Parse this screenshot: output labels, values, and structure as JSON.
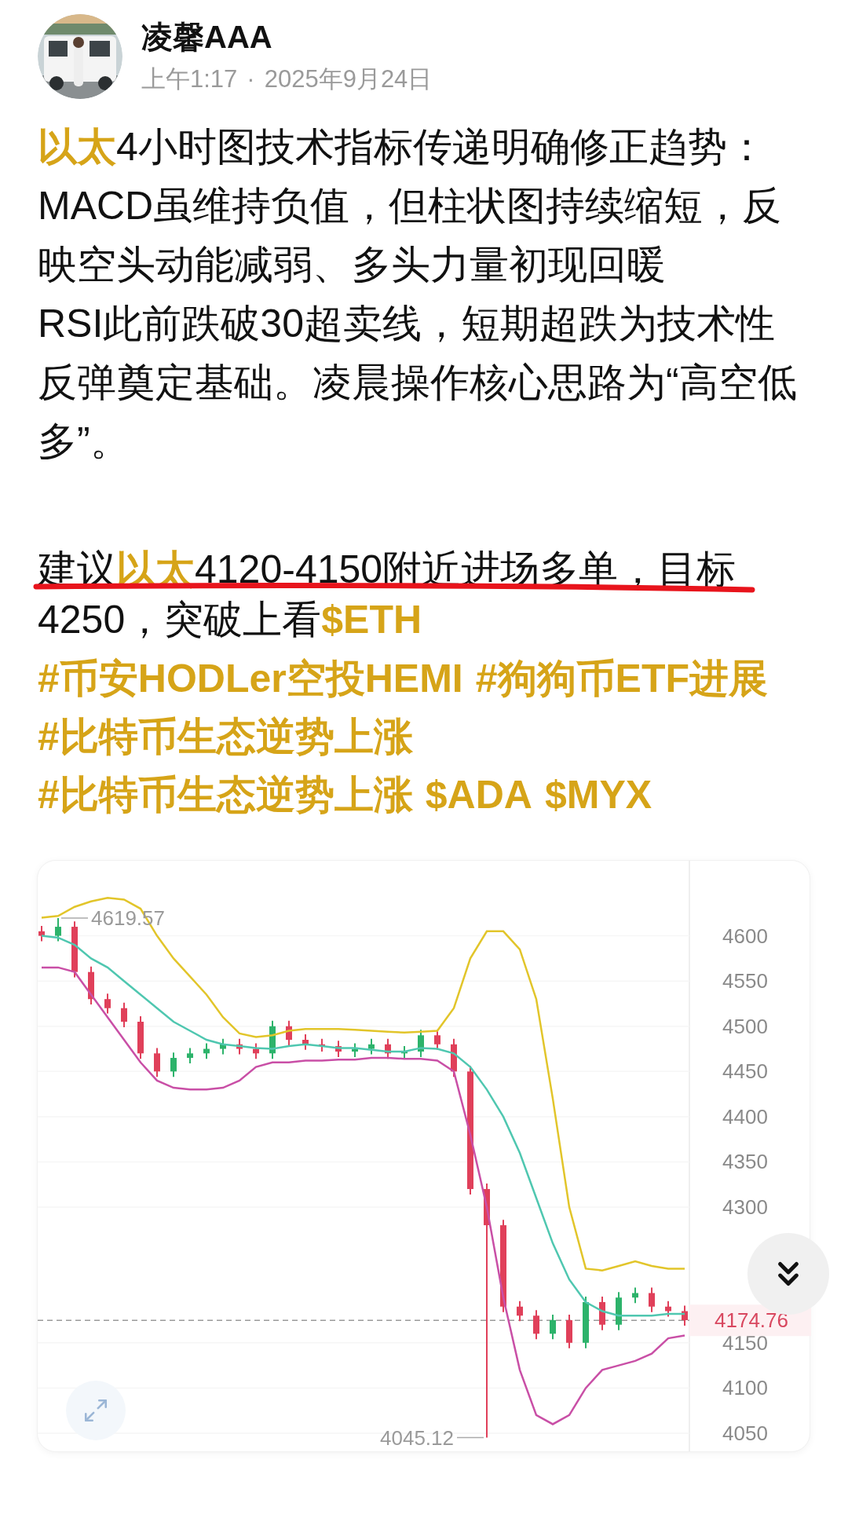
{
  "post": {
    "author": {
      "name": "凌馨AAA",
      "time": "上午1:17",
      "separator": "·",
      "date": "2025年9月24日"
    },
    "paragraphs": [
      "**以太**4小时图技术指标传递明确修正趋势：MACD虽维持负值，但柱状图持续缩短，反映空头动能减弱、多头力量初现回暖",
      "RSI此前跌破30超卖线，短期超跌为技术性反弹奠定基础。凌晨操作核心思路为“高空低多”。"
    ],
    "advice_lines": [
      {
        "text": "建议**以太**4120-4150附近进场多单，目标",
        "underlined": true
      },
      {
        "text": "4250，突破上看**$ETH**"
      }
    ],
    "tag_lines": [
      [
        "#币安HODLer空投HEMI",
        "#狗狗币ETF进展"
      ],
      [
        "#比特币生态逆势上涨"
      ],
      [
        "#比特币生态逆势上涨",
        "$ADA",
        "$MYX"
      ]
    ],
    "chart": {
      "chart_data": {
        "type": "candlestick",
        "grid": true,
        "ylim": [
          4030,
          4683
        ],
        "yticks": [
          4600,
          4550,
          4500,
          4450,
          4400,
          4350,
          4300,
          4150,
          4100,
          4050
        ],
        "ohlc": [
          [
            4605,
            4611,
            4594,
            4600
          ],
          [
            4600,
            4619.57,
            4594,
            4610
          ],
          [
            4610,
            4616,
            4554,
            4560
          ],
          [
            4560,
            4566,
            4524,
            4530
          ],
          [
            4530,
            4536,
            4514,
            4520
          ],
          [
            4520,
            4526,
            4499,
            4505
          ],
          [
            4505,
            4511,
            4464,
            4470
          ],
          [
            4470,
            4476,
            4444,
            4450
          ],
          [
            4450,
            4471,
            4444,
            4465
          ],
          [
            4465,
            4476,
            4459,
            4470
          ],
          [
            4470,
            4481,
            4464,
            4475
          ],
          [
            4475,
            4486,
            4469,
            4480
          ],
          [
            4480,
            4486,
            4469,
            4475
          ],
          [
            4475,
            4481,
            4464,
            4470
          ],
          [
            4470,
            4506,
            4464,
            4500
          ],
          [
            4500,
            4506,
            4479,
            4485
          ],
          [
            4485,
            4491,
            4474,
            4480
          ],
          [
            4480,
            4486,
            4472,
            4478
          ],
          [
            4478,
            4484,
            4466,
            4472
          ],
          [
            4472,
            4481,
            4466,
            4475
          ],
          [
            4475,
            4486,
            4469,
            4480
          ],
          [
            4480,
            4486,
            4464,
            4470
          ],
          [
            4470,
            4478,
            4464,
            4472
          ],
          [
            4472,
            4496,
            4466,
            4490
          ],
          [
            4490,
            4496,
            4474,
            4480
          ],
          [
            4480,
            4486,
            4444,
            4450
          ],
          [
            4450,
            4456,
            4314,
            4320
          ],
          [
            4320,
            4326,
            4045.12,
            4280
          ],
          [
            4280,
            4286,
            4184,
            4190
          ],
          [
            4190,
            4196,
            4174,
            4180
          ],
          [
            4180,
            4186,
            4154,
            4160
          ],
          [
            4160,
            4181,
            4154,
            4175
          ],
          [
            4175,
            4181,
            4144,
            4150
          ],
          [
            4150,
            4201,
            4144,
            4195
          ],
          [
            4195,
            4201,
            4164,
            4170
          ],
          [
            4170,
            4206,
            4164,
            4200
          ],
          [
            4200,
            4211,
            4194,
            4205
          ],
          [
            4205,
            4211,
            4184,
            4190
          ],
          [
            4190,
            4196,
            4179,
            4185
          ],
          [
            4185,
            4191,
            4169,
            4175
          ]
        ],
        "series": [
          {
            "type": "line",
            "color": "#e2c52a",
            "values": [
              4620,
              4622,
              4632,
              4638,
              4642,
              4640,
              4630,
              4600,
              4575,
              4555,
              4535,
              4510,
              4492,
              4488,
              4490,
              4495,
              4497,
              4497,
              4497,
              4496,
              4495,
              4494,
              4493,
              4494,
              4495,
              4520,
              4575,
              4605,
              4605,
              4585,
              4530,
              4420,
              4300,
              4232,
              4230,
              4235,
              4240,
              4235,
              4232,
              4232
            ]
          },
          {
            "type": "line",
            "color": "#4fc7b0",
            "values": [
              4600,
              4598,
              4590,
              4575,
              4565,
              4550,
              4535,
              4520,
              4505,
              4495,
              4485,
              4480,
              4478,
              4476,
              4475,
              4478,
              4480,
              4478,
              4476,
              4476,
              4474,
              4472,
              4472,
              4476,
              4475,
              4470,
              4455,
              4430,
              4400,
              4360,
              4310,
              4260,
              4220,
              4195,
              4185,
              4180,
              4180,
              4180,
              4182,
              4182
            ]
          },
          {
            "type": "line",
            "color": "#c94fa6",
            "values": [
              4565,
              4565,
              4560,
              4535,
              4510,
              4485,
              4460,
              4440,
              4432,
              4430,
              4430,
              4432,
              4440,
              4455,
              4460,
              4460,
              4462,
              4462,
              4463,
              4463,
              4465,
              4465,
              4464,
              4464,
              4462,
              4450,
              4380,
              4300,
              4200,
              4120,
              4070,
              4060,
              4070,
              4100,
              4120,
              4125,
              4130,
              4138,
              4155,
              4158
            ]
          }
        ],
        "annotations": [
          "4619.57",
          "4045.12"
        ],
        "ref_lines": [
          {
            "axis": "y",
            "value": 4174.76,
            "label": "4174.76"
          }
        ]
      }
    }
  }
}
